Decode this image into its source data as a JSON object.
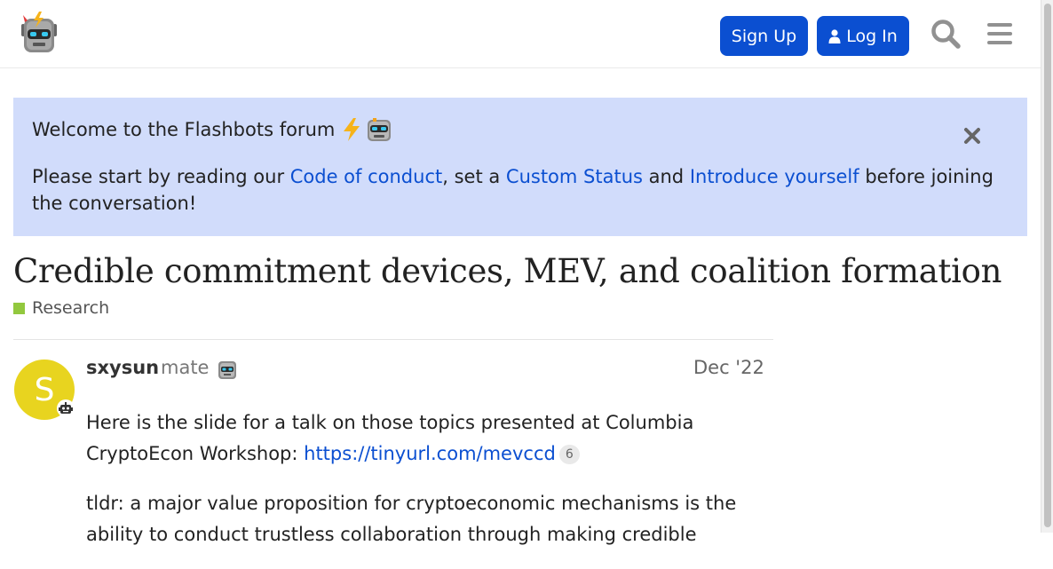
{
  "header": {
    "signup_label": "Sign Up",
    "login_label": "Log In"
  },
  "banner": {
    "title": "Welcome to the Flashbots forum",
    "body_prefix": "Please start by reading our ",
    "link_conduct": "Code of conduct",
    "body_mid1": ", set a ",
    "link_status": "Custom Status",
    "body_mid2": " and ",
    "link_intro": "Introduce yourself",
    "body_suffix": " before joining the conversation!"
  },
  "topic": {
    "title": "Credible commitment devices, MEV, and coalition formation",
    "category": "Research",
    "category_color": "#92c83e"
  },
  "post": {
    "avatar_letter": "S",
    "avatar_color": "#e8d41f",
    "username": "sxysun",
    "user_title": "mate",
    "date": "Dec '22",
    "para1_prefix": "Here is the slide for a talk on those topics presented at Columbia CryptoEcon Workshop: ",
    "para1_link": "https://tinyurl.com/mevccd",
    "para1_clicks": "6",
    "para2": "tldr: a major value proposition for cryptoeconomic mechanisms is the ability to conduct trustless collaboration through making credible"
  },
  "colors": {
    "accent": "#0b4fd1",
    "banner_bg": "#d1dcfb"
  }
}
